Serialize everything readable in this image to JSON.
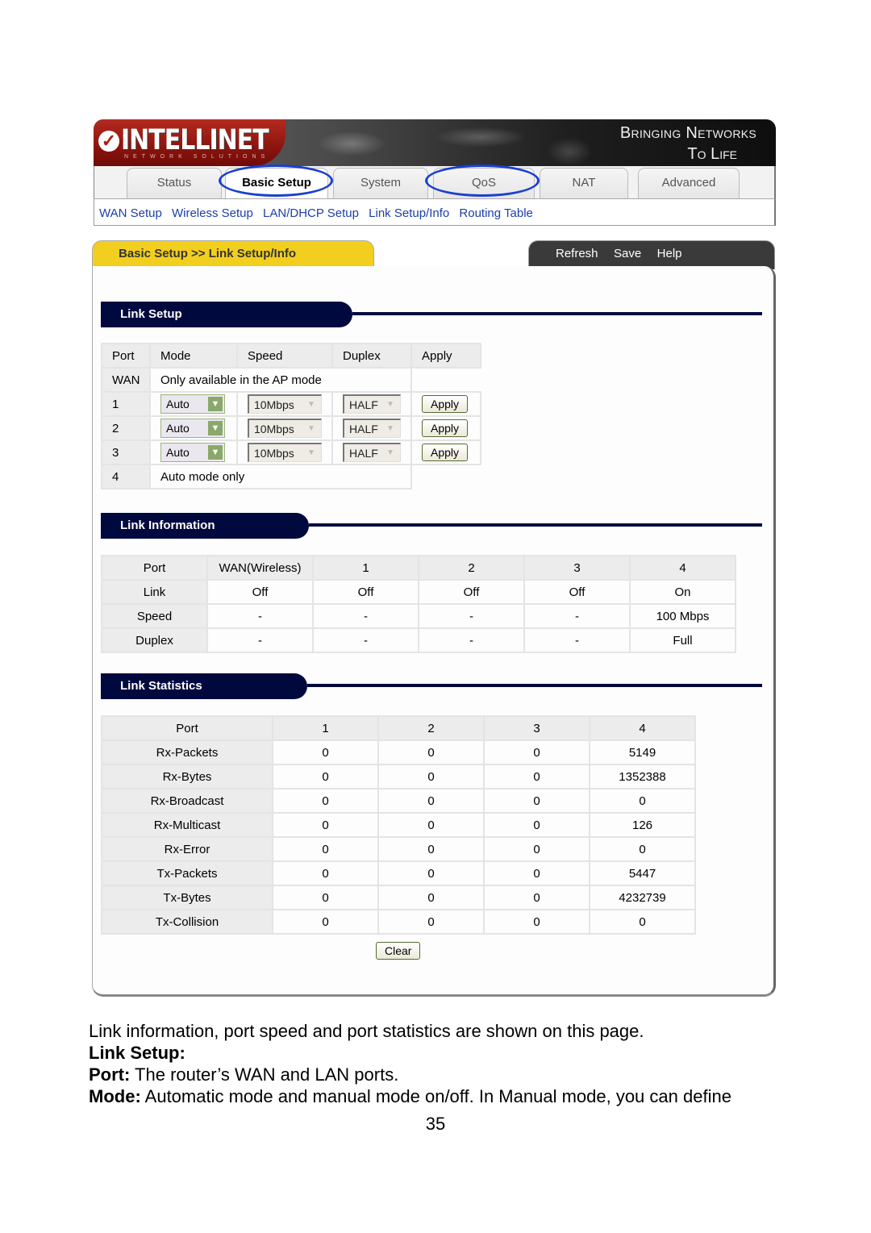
{
  "router_ui": {
    "brand": {
      "name": "INTELLINET",
      "subtitle": "NETWORK SOLUTIONS",
      "tagline_line1": "Bringing Networks",
      "tagline_line2": "To Life"
    },
    "tabs": [
      {
        "label": "Status",
        "active": false,
        "highlighted": false
      },
      {
        "label": "Basic Setup",
        "active": true,
        "highlighted": true
      },
      {
        "label": "System",
        "active": false,
        "highlighted": false
      },
      {
        "label": "QoS",
        "active": false,
        "highlighted": true
      },
      {
        "label": "NAT",
        "active": false,
        "highlighted": false
      },
      {
        "label": "Advanced",
        "active": false,
        "highlighted": false
      }
    ],
    "subnav": [
      "WAN Setup",
      "Wireless Setup",
      "LAN/DHCP Setup",
      "Link Setup/Info",
      "Routing Table"
    ],
    "breadcrumb": "Basic Setup >> Link Setup/Info",
    "actions": [
      "Refresh",
      "Save",
      "Help"
    ],
    "link_setup": {
      "title": "Link Setup",
      "headers": [
        "Port",
        "Mode",
        "Speed",
        "Duplex",
        "Apply"
      ],
      "wan_row": {
        "port": "WAN",
        "note": "Only available in the AP mode"
      },
      "rows": [
        {
          "port": "1",
          "mode": "Auto",
          "speed": "10Mbps",
          "duplex": "HALF",
          "apply": "Apply"
        },
        {
          "port": "2",
          "mode": "Auto",
          "speed": "10Mbps",
          "duplex": "HALF",
          "apply": "Apply"
        },
        {
          "port": "3",
          "mode": "Auto",
          "speed": "10Mbps",
          "duplex": "HALF",
          "apply": "Apply"
        }
      ],
      "port4_row": {
        "port": "4",
        "note": "Auto mode only"
      }
    },
    "link_information": {
      "title": "Link Information",
      "headers": [
        "Port",
        "WAN(Wireless)",
        "1",
        "2",
        "3",
        "4"
      ],
      "rows": [
        [
          "Link",
          "Off",
          "Off",
          "Off",
          "Off",
          "On"
        ],
        [
          "Speed",
          "-",
          "-",
          "-",
          "-",
          "100 Mbps"
        ],
        [
          "Duplex",
          "-",
          "-",
          "-",
          "-",
          "Full"
        ]
      ]
    },
    "link_statistics": {
      "title": "Link Statistics",
      "headers": [
        "Port",
        "1",
        "2",
        "3",
        "4"
      ],
      "rows": [
        [
          "Rx-Packets",
          "0",
          "0",
          "0",
          "5149"
        ],
        [
          "Rx-Bytes",
          "0",
          "0",
          "0",
          "1352388"
        ],
        [
          "Rx-Broadcast",
          "0",
          "0",
          "0",
          "0"
        ],
        [
          "Rx-Multicast",
          "0",
          "0",
          "0",
          "126"
        ],
        [
          "Rx-Error",
          "0",
          "0",
          "0",
          "0"
        ],
        [
          "Tx-Packets",
          "0",
          "0",
          "0",
          "5447"
        ],
        [
          "Tx-Bytes",
          "0",
          "0",
          "0",
          "4232739"
        ],
        [
          "Tx-Collision",
          "0",
          "0",
          "0",
          "0"
        ]
      ],
      "clear_label": "Clear"
    }
  },
  "document": {
    "intro": "Link information, port speed and port statistics are shown on this page.",
    "heading": "Link Setup:",
    "port_term": "Port:",
    "port_desc": " The router’s WAN and LAN ports.",
    "mode_term": "Mode:",
    "mode_desc": " Automatic mode and manual mode on/off. In Manual mode, you can define",
    "page_number": "35"
  },
  "colors": {
    "highlight_circle": "#1a3fd0",
    "section_bar": "#00093e",
    "breadcrumb_tab": "#f2cf1f",
    "link": "#1d3fa8"
  }
}
